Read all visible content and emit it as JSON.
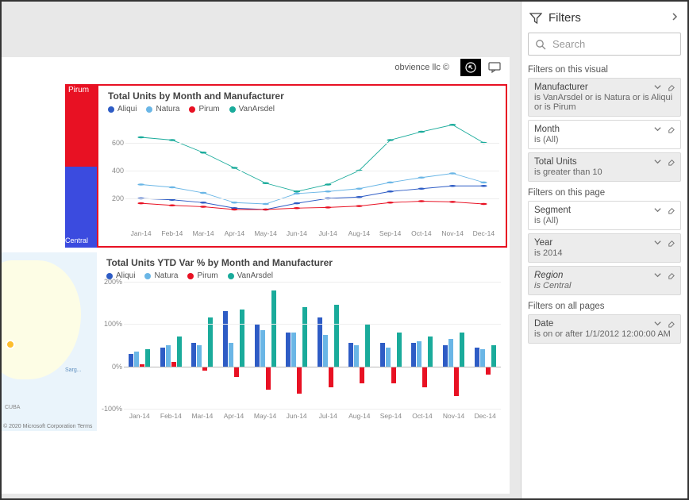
{
  "header": {
    "brand": "obvience llc ©"
  },
  "legend": {
    "series": [
      {
        "name": "Aliqui",
        "color": "#2e5cc5"
      },
      {
        "name": "Natura",
        "color": "#6ab6e6"
      },
      {
        "name": "Pirum",
        "color": "#e81123"
      },
      {
        "name": "VanArsdel",
        "color": "#1aab9b"
      }
    ]
  },
  "chart_data": [
    {
      "type": "line",
      "title": "Total Units by Month and Manufacturer",
      "xlabel": "",
      "ylabel": "",
      "ylim": [
        0,
        800
      ],
      "yticks": [
        200,
        400,
        600
      ],
      "categories": [
        "Jan-14",
        "Feb-14",
        "Mar-14",
        "Apr-14",
        "May-14",
        "Jun-14",
        "Jul-14",
        "Aug-14",
        "Sep-14",
        "Oct-14",
        "Nov-14",
        "Dec-14"
      ],
      "series": [
        {
          "name": "Aliqui",
          "color": "#2e5cc5",
          "values": [
            200,
            190,
            170,
            130,
            120,
            165,
            200,
            210,
            250,
            270,
            290,
            290
          ]
        },
        {
          "name": "Natura",
          "color": "#6ab6e6",
          "values": [
            300,
            280,
            240,
            170,
            160,
            235,
            250,
            270,
            315,
            350,
            380,
            315
          ]
        },
        {
          "name": "Pirum",
          "color": "#e81123",
          "values": [
            165,
            150,
            140,
            120,
            120,
            130,
            135,
            145,
            170,
            180,
            175,
            160
          ]
        },
        {
          "name": "VanArsdel",
          "color": "#1aab9b",
          "values": [
            640,
            620,
            530,
            420,
            310,
            250,
            300,
            400,
            620,
            680,
            730,
            600
          ]
        }
      ]
    },
    {
      "type": "bar",
      "title": "Total Units YTD Var % by Month and Manufacturer",
      "xlabel": "",
      "ylabel": "",
      "ylim": [
        -100,
        200
      ],
      "yticks": [
        -100,
        0,
        100,
        200
      ],
      "categories": [
        "Jan-14",
        "Feb-14",
        "Mar-14",
        "Apr-14",
        "May-14",
        "Jun-14",
        "Jul-14",
        "Aug-14",
        "Sep-14",
        "Oct-14",
        "Nov-14",
        "Dec-14"
      ],
      "series": [
        {
          "name": "Aliqui",
          "color": "#2e5cc5",
          "values": [
            30,
            45,
            55,
            130,
            100,
            80,
            115,
            55,
            55,
            55,
            50,
            45
          ]
        },
        {
          "name": "Natura",
          "color": "#6ab6e6",
          "values": [
            35,
            50,
            50,
            55,
            85,
            80,
            75,
            50,
            45,
            60,
            65,
            40
          ]
        },
        {
          "name": "Pirum",
          "color": "#e81123",
          "values": [
            5,
            10,
            -10,
            -25,
            -55,
            -65,
            -50,
            -40,
            -40,
            -50,
            -70,
            -20
          ]
        },
        {
          "name": "VanArsdel",
          "color": "#1aab9b",
          "values": [
            40,
            70,
            115,
            135,
            180,
            140,
            145,
            100,
            80,
            70,
            80,
            50
          ]
        }
      ]
    }
  ],
  "tiles": {
    "pirum_label": "Pirum",
    "central_label": "Central",
    "map_attrib": "© 2020 Microsoft Corporation  Terms"
  },
  "filters": {
    "title": "Filters",
    "search_placeholder": "Search",
    "sections": {
      "visual_label": "Filters on this visual",
      "page_label": "Filters on this page",
      "all_label": "Filters on all pages"
    },
    "visual": [
      {
        "name": "Manufacturer",
        "desc": "is VanArsdel or is Natura or is Aliqui or is Pirum",
        "active": true
      },
      {
        "name": "Month",
        "desc": "is (All)",
        "active": false
      },
      {
        "name": "Total Units",
        "desc": "is greater than 10",
        "active": true
      }
    ],
    "page": [
      {
        "name": "Segment",
        "desc": "is (All)",
        "active": false
      },
      {
        "name": "Year",
        "desc": "is 2014",
        "active": true
      },
      {
        "name": "Region",
        "desc": "is Central",
        "active": true,
        "italic": true
      }
    ],
    "all": [
      {
        "name": "Date",
        "desc": "is on or after 1/1/2012 12:00:00 AM",
        "active": true
      }
    ]
  }
}
